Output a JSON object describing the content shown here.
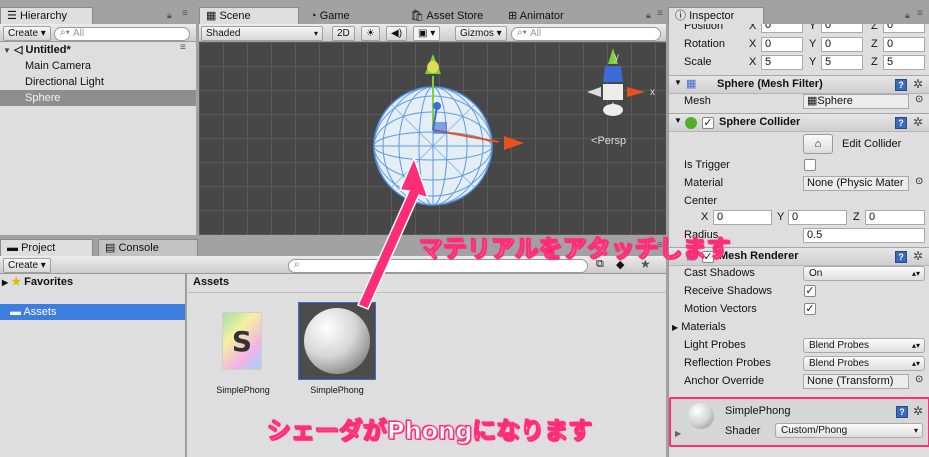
{
  "hierarchy": {
    "tab": "Hierarchy",
    "create": "Create",
    "search_placeholder": "All",
    "scene_name": "Untitled*",
    "items": [
      "Main Camera",
      "Directional Light",
      "Sphere"
    ]
  },
  "scene": {
    "tabs": [
      "Scene",
      "Game",
      "Asset Store",
      "Animator"
    ],
    "shading": "Shaded",
    "mode_2d": "2D",
    "gizmos": "Gizmos",
    "search_placeholder": "All",
    "persp": "Persp"
  },
  "project": {
    "tabs": [
      "Project",
      "Console"
    ],
    "create": "Create",
    "favorites": "Favorites",
    "assets_folder": "Assets",
    "breadcrumb": "Assets",
    "items": [
      {
        "name": "SimplePhong",
        "kind": "shader"
      },
      {
        "name": "SimplePhong",
        "kind": "material"
      }
    ]
  },
  "inspector": {
    "tab": "Inspector",
    "transform": {
      "rows": [
        {
          "label": "Position",
          "x": "0",
          "y": "0",
          "z": "0"
        },
        {
          "label": "Rotation",
          "x": "0",
          "y": "0",
          "z": "0"
        },
        {
          "label": "Scale",
          "x": "5",
          "y": "5",
          "z": "5"
        }
      ]
    },
    "mesh_filter": {
      "title": "Sphere (Mesh Filter)",
      "mesh_label": "Mesh",
      "mesh_value": "Sphere"
    },
    "sphere_collider": {
      "title": "Sphere Collider",
      "edit_button": "Edit Collider",
      "is_trigger_label": "Is Trigger",
      "material_label": "Material",
      "material_value": "None (Physic Mater",
      "center_label": "Center",
      "center": {
        "x": "0",
        "y": "0",
        "z": "0"
      },
      "radius_label": "Radius",
      "radius_value": "0.5"
    },
    "mesh_renderer": {
      "title": "Mesh Renderer",
      "cast_shadows_label": "Cast Shadows",
      "cast_shadows_value": "On",
      "receive_shadows_label": "Receive Shadows",
      "motion_vectors_label": "Motion Vectors",
      "materials_label": "Materials",
      "light_probes_label": "Light Probes",
      "light_probes_value": "Blend Probes",
      "reflection_probes_label": "Reflection Probes",
      "reflection_probes_value": "Blend Probes",
      "anchor_override_label": "Anchor Override",
      "anchor_override_value": "None (Transform)"
    },
    "material": {
      "name": "SimplePhong",
      "shader_label": "Shader",
      "shader_value": "Custom/Phong"
    }
  },
  "annotations": {
    "attach_material": "マテリアルをアタッチします",
    "shader_phong": "シェーダがPhongになります"
  },
  "colors": {
    "selection": "#3e7de0",
    "annotation": "#ff2d78",
    "scene_bg": "#474747"
  }
}
